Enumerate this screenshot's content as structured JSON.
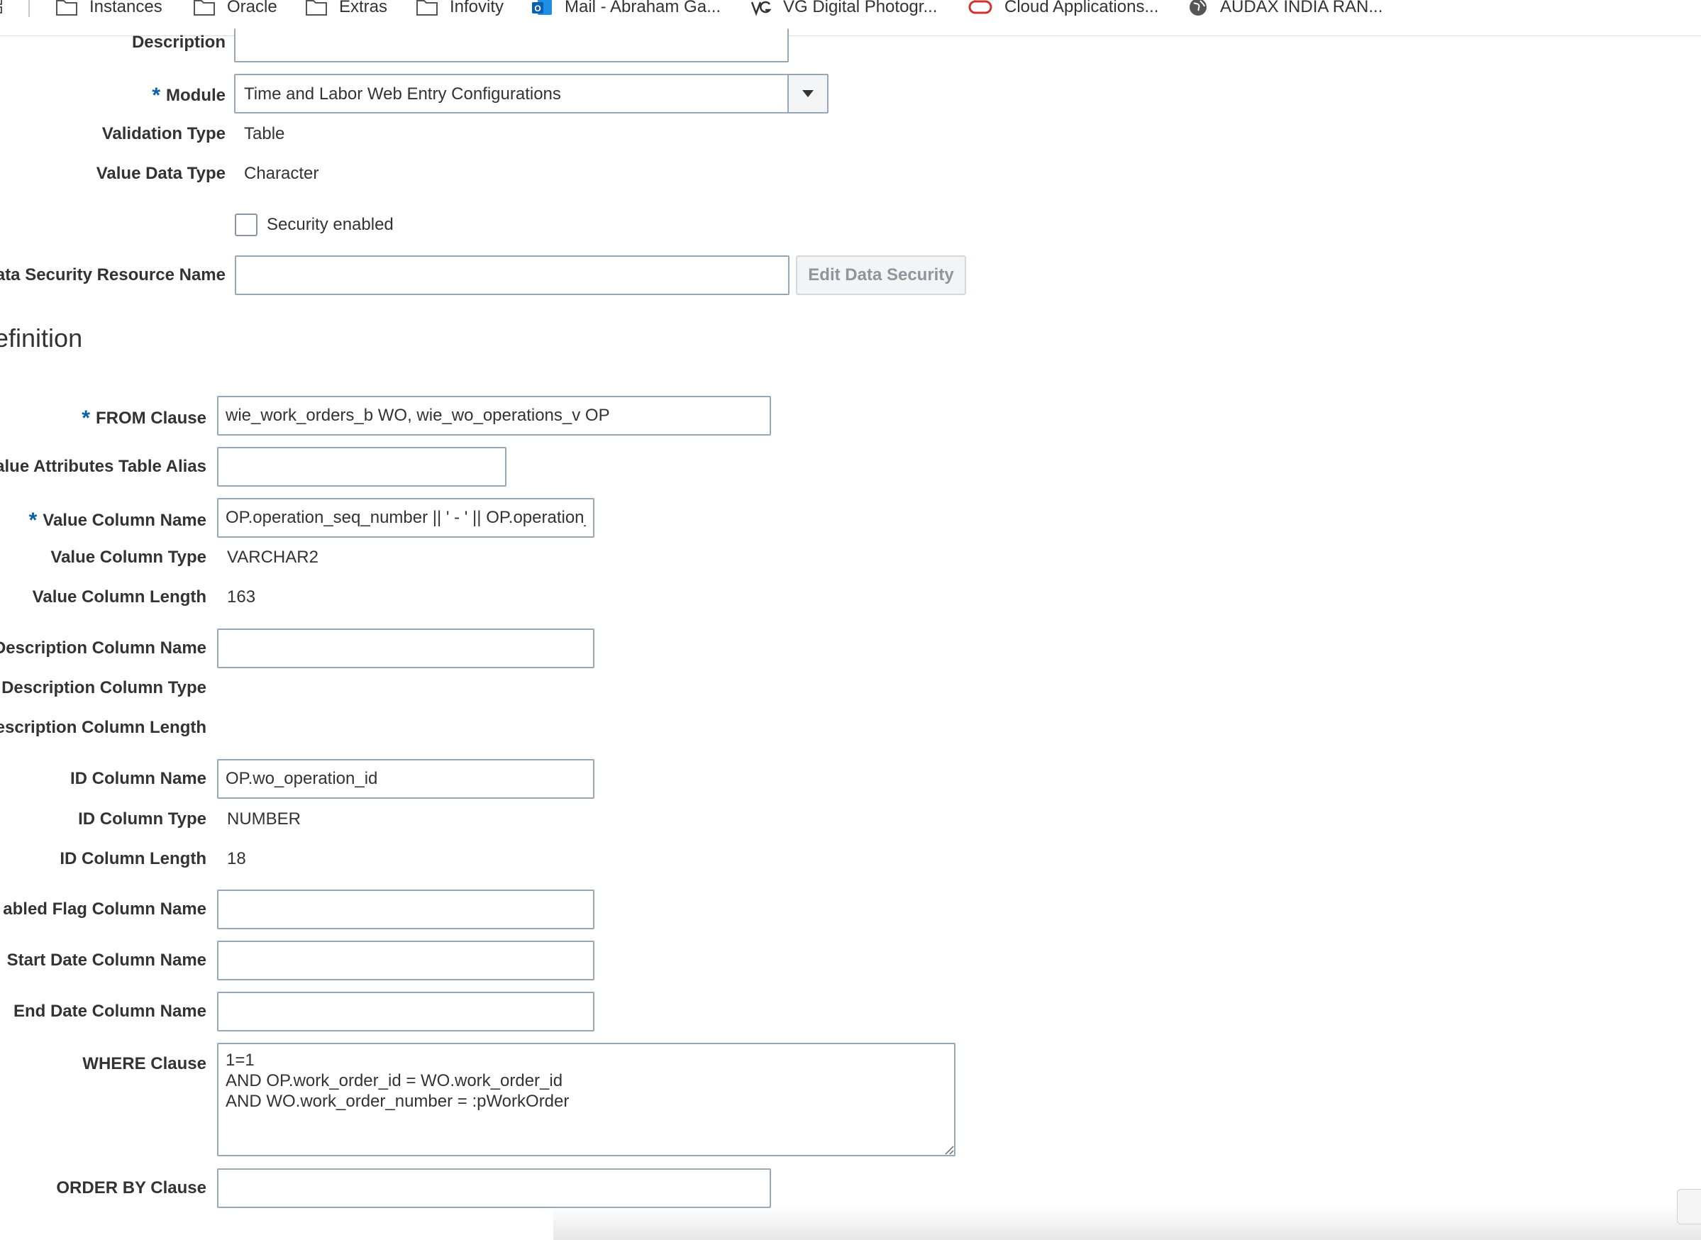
{
  "bookmarks": {
    "items": [
      {
        "label": "Instances",
        "icon": "folder-icon"
      },
      {
        "label": "Oracle",
        "icon": "folder-icon"
      },
      {
        "label": "Extras",
        "icon": "folder-icon"
      },
      {
        "label": "Infovity",
        "icon": "folder-icon"
      },
      {
        "label": "Mail - Abraham Ga...",
        "icon": "outlook-icon"
      },
      {
        "label": "VG Digital Photogr...",
        "icon": "vg-logo-icon"
      },
      {
        "label": "Cloud Applications...",
        "icon": "oracle-logo-icon"
      },
      {
        "label": "AUDAX INDIA RAN...",
        "icon": "globe-icon"
      }
    ]
  },
  "form": {
    "description_label": "Description",
    "description_value": "",
    "module_required": "*",
    "module_label": "Module",
    "module_value": "Time and Labor Web Entry Configurations",
    "validation_type_label": "Validation Type",
    "validation_type_value": "Table",
    "value_data_type_label": "Value Data Type",
    "value_data_type_value": "Character",
    "security_enabled_label": "Security enabled",
    "security_enabled_checked": false,
    "data_security_label": "ata Security Resource Name",
    "data_security_value": "",
    "edit_data_security_label": "Edit Data Security"
  },
  "definition": {
    "section_title": "efinition",
    "required_marker": "*",
    "from_clause_label": "FROM Clause",
    "from_clause_value": "wie_work_orders_b WO, wie_wo_operations_v OP",
    "alias_label": "alue Attributes Table Alias",
    "alias_value": "",
    "value_column_name_label": "Value Column Name",
    "value_column_name_value": "OP.operation_seq_number || ' - ' || OP.operation_",
    "value_column_type_label": "Value Column Type",
    "value_column_type_value": "VARCHAR2",
    "value_column_length_label": "Value Column Length",
    "value_column_length_value": "163",
    "desc_column_name_label": "Description Column Name",
    "desc_column_name_value": "",
    "desc_column_type_label": "Description Column Type",
    "desc_column_length_label": "escription Column Length",
    "id_column_name_label": "ID Column Name",
    "id_column_name_value": "OP.wo_operation_id",
    "id_column_type_label": "ID Column Type",
    "id_column_type_value": "NUMBER",
    "id_column_length_label": "ID Column Length",
    "id_column_length_value": "18",
    "enabled_flag_label": "abled Flag Column Name",
    "enabled_flag_value": "",
    "start_date_label": "Start Date Column Name",
    "start_date_value": "",
    "end_date_label": "End Date Column Name",
    "end_date_value": "",
    "where_clause_label": "WHERE Clause",
    "where_clause_value": "1=1\nAND OP.work_order_id = WO.work_order_id\nAND WO.work_order_number = :pWorkOrder",
    "order_by_label": "ORDER BY Clause",
    "order_by_value": ""
  },
  "colors": {
    "required": "#0a60a8",
    "border": "#9aa8b5"
  }
}
